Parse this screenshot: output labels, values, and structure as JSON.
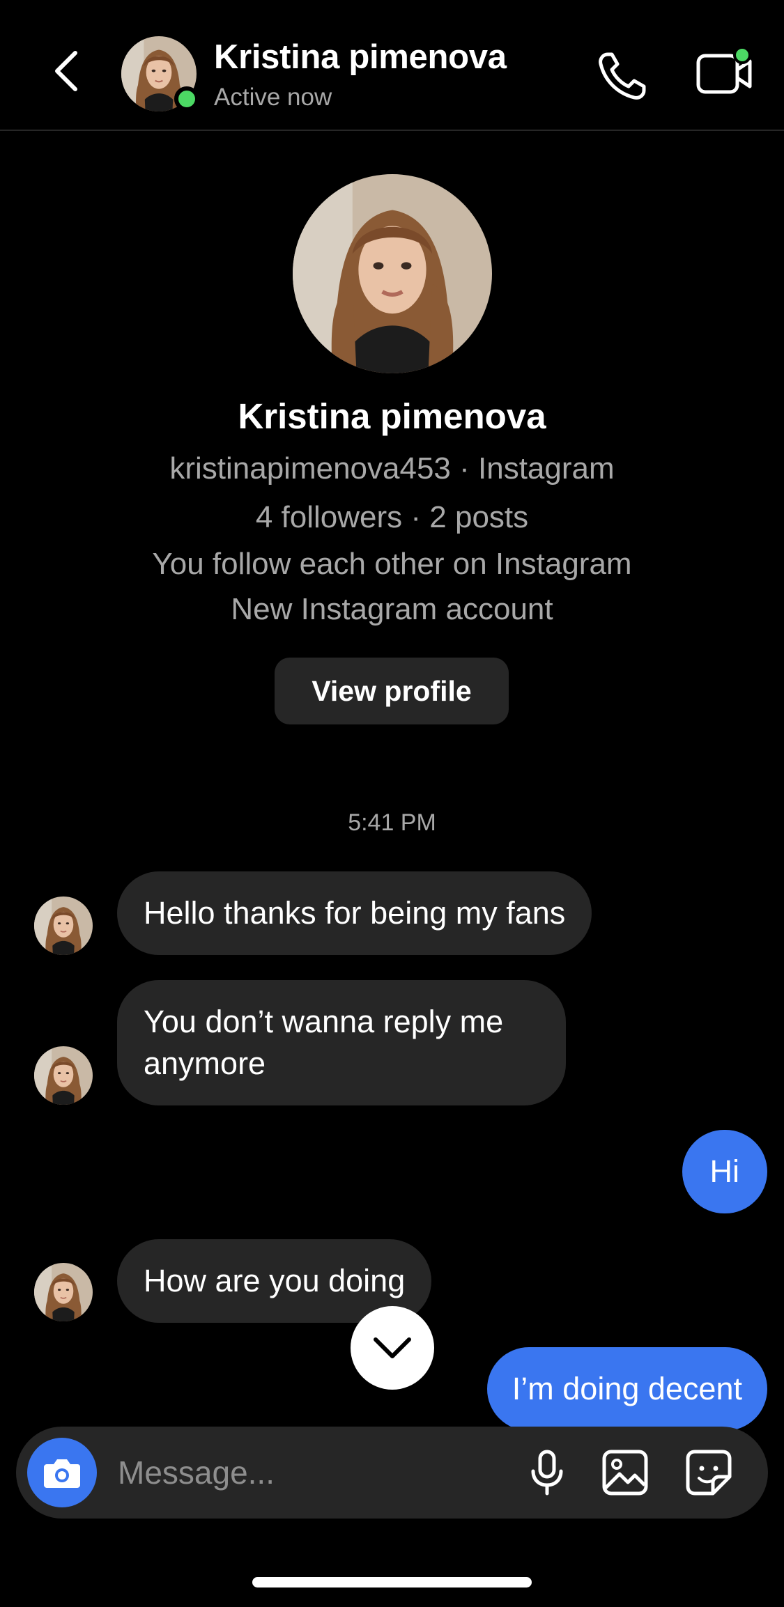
{
  "header": {
    "name": "Kristina pimenova",
    "status": "Active now"
  },
  "profile": {
    "name": "Kristina pimenova",
    "username_line": "kristinapimenova453 · Instagram",
    "stats_line": "4 followers · 2 posts",
    "mutual_line": "You follow each other on Instagram",
    "account_line": "New Instagram account",
    "view_profile_label": "View profile"
  },
  "timestamp": "5:41 PM",
  "messages": [
    {
      "from": "them",
      "text": "Hello thanks for being my fans"
    },
    {
      "from": "them",
      "text": "You don’t wanna reply me anymore"
    },
    {
      "from": "me",
      "text": "Hi"
    },
    {
      "from": "them",
      "text": "How are you doing"
    },
    {
      "from": "me",
      "text": "I’m doing decent"
    }
  ],
  "composer": {
    "placeholder": "Message..."
  },
  "colors": {
    "background": "#000000",
    "incoming_bubble": "#262626",
    "outgoing_bubble": "#3a76f0",
    "online": "#4cd964",
    "secondary_text": "#a8a8a8"
  },
  "icons": {
    "back": "chevron-left-icon",
    "call": "phone-icon",
    "video": "video-camera-icon",
    "scroll": "chevron-down-icon",
    "camera": "camera-icon",
    "mic": "microphone-icon",
    "gallery": "image-icon",
    "sticker": "sticker-icon"
  }
}
